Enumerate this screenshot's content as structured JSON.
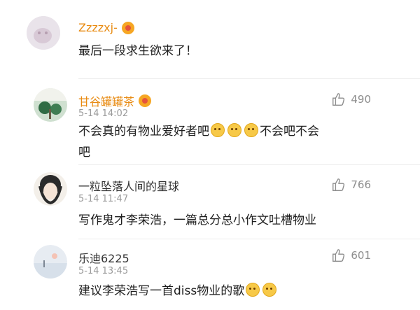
{
  "comments": [
    {
      "user": "Zzzzxj-",
      "time": "",
      "text": "最后一段求生欲来了！",
      "likes": ""
    },
    {
      "user": "甘谷罐罐茶",
      "time": "5-14 14:02",
      "text_line1_before": "不会真的有物业爱好者吧",
      "text_line1_after": "不会吧不会",
      "text_line2": "吧",
      "likes": "490"
    },
    {
      "user": "一粒坠落人间的星球",
      "time": "5-14 11:47",
      "text": "写作鬼才李荣浩，一篇总分总小作文吐槽物业",
      "likes": "766"
    },
    {
      "user": "乐迪6225",
      "time": "5-14 13:45",
      "text": "建议李荣浩写一首diss物业的歌",
      "likes": "601"
    }
  ],
  "colors": {
    "vip_name": "#e88a10",
    "plain_name": "#333333",
    "meta": "#9a9a9a"
  },
  "icons": {
    "like": "thumbs-up-icon",
    "vip": "vip-badge-icon",
    "emoji": "smile-emoji-icon"
  }
}
